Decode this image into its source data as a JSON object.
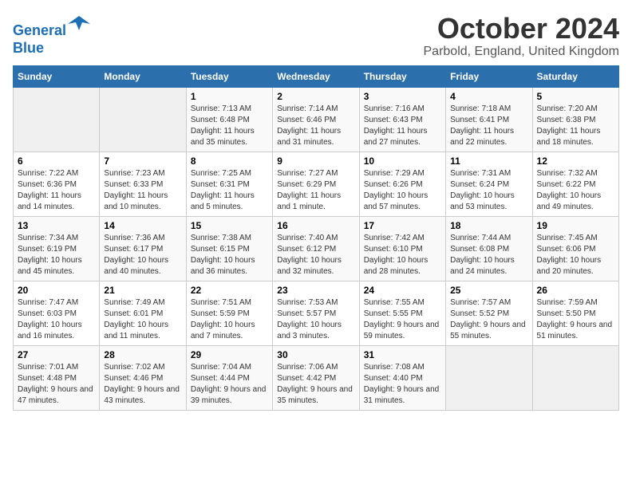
{
  "logo": {
    "line1": "General",
    "line2": "Blue"
  },
  "title": "October 2024",
  "location": "Parbold, England, United Kingdom",
  "headers": [
    "Sunday",
    "Monday",
    "Tuesday",
    "Wednesday",
    "Thursday",
    "Friday",
    "Saturday"
  ],
  "weeks": [
    [
      {
        "day": "",
        "info": ""
      },
      {
        "day": "",
        "info": ""
      },
      {
        "day": "1",
        "info": "Sunrise: 7:13 AM\nSunset: 6:48 PM\nDaylight: 11 hours and 35 minutes."
      },
      {
        "day": "2",
        "info": "Sunrise: 7:14 AM\nSunset: 6:46 PM\nDaylight: 11 hours and 31 minutes."
      },
      {
        "day": "3",
        "info": "Sunrise: 7:16 AM\nSunset: 6:43 PM\nDaylight: 11 hours and 27 minutes."
      },
      {
        "day": "4",
        "info": "Sunrise: 7:18 AM\nSunset: 6:41 PM\nDaylight: 11 hours and 22 minutes."
      },
      {
        "day": "5",
        "info": "Sunrise: 7:20 AM\nSunset: 6:38 PM\nDaylight: 11 hours and 18 minutes."
      }
    ],
    [
      {
        "day": "6",
        "info": "Sunrise: 7:22 AM\nSunset: 6:36 PM\nDaylight: 11 hours and 14 minutes."
      },
      {
        "day": "7",
        "info": "Sunrise: 7:23 AM\nSunset: 6:33 PM\nDaylight: 11 hours and 10 minutes."
      },
      {
        "day": "8",
        "info": "Sunrise: 7:25 AM\nSunset: 6:31 PM\nDaylight: 11 hours and 5 minutes."
      },
      {
        "day": "9",
        "info": "Sunrise: 7:27 AM\nSunset: 6:29 PM\nDaylight: 11 hours and 1 minute."
      },
      {
        "day": "10",
        "info": "Sunrise: 7:29 AM\nSunset: 6:26 PM\nDaylight: 10 hours and 57 minutes."
      },
      {
        "day": "11",
        "info": "Sunrise: 7:31 AM\nSunset: 6:24 PM\nDaylight: 10 hours and 53 minutes."
      },
      {
        "day": "12",
        "info": "Sunrise: 7:32 AM\nSunset: 6:22 PM\nDaylight: 10 hours and 49 minutes."
      }
    ],
    [
      {
        "day": "13",
        "info": "Sunrise: 7:34 AM\nSunset: 6:19 PM\nDaylight: 10 hours and 45 minutes."
      },
      {
        "day": "14",
        "info": "Sunrise: 7:36 AM\nSunset: 6:17 PM\nDaylight: 10 hours and 40 minutes."
      },
      {
        "day": "15",
        "info": "Sunrise: 7:38 AM\nSunset: 6:15 PM\nDaylight: 10 hours and 36 minutes."
      },
      {
        "day": "16",
        "info": "Sunrise: 7:40 AM\nSunset: 6:12 PM\nDaylight: 10 hours and 32 minutes."
      },
      {
        "day": "17",
        "info": "Sunrise: 7:42 AM\nSunset: 6:10 PM\nDaylight: 10 hours and 28 minutes."
      },
      {
        "day": "18",
        "info": "Sunrise: 7:44 AM\nSunset: 6:08 PM\nDaylight: 10 hours and 24 minutes."
      },
      {
        "day": "19",
        "info": "Sunrise: 7:45 AM\nSunset: 6:06 PM\nDaylight: 10 hours and 20 minutes."
      }
    ],
    [
      {
        "day": "20",
        "info": "Sunrise: 7:47 AM\nSunset: 6:03 PM\nDaylight: 10 hours and 16 minutes."
      },
      {
        "day": "21",
        "info": "Sunrise: 7:49 AM\nSunset: 6:01 PM\nDaylight: 10 hours and 11 minutes."
      },
      {
        "day": "22",
        "info": "Sunrise: 7:51 AM\nSunset: 5:59 PM\nDaylight: 10 hours and 7 minutes."
      },
      {
        "day": "23",
        "info": "Sunrise: 7:53 AM\nSunset: 5:57 PM\nDaylight: 10 hours and 3 minutes."
      },
      {
        "day": "24",
        "info": "Sunrise: 7:55 AM\nSunset: 5:55 PM\nDaylight: 9 hours and 59 minutes."
      },
      {
        "day": "25",
        "info": "Sunrise: 7:57 AM\nSunset: 5:52 PM\nDaylight: 9 hours and 55 minutes."
      },
      {
        "day": "26",
        "info": "Sunrise: 7:59 AM\nSunset: 5:50 PM\nDaylight: 9 hours and 51 minutes."
      }
    ],
    [
      {
        "day": "27",
        "info": "Sunrise: 7:01 AM\nSunset: 4:48 PM\nDaylight: 9 hours and 47 minutes."
      },
      {
        "day": "28",
        "info": "Sunrise: 7:02 AM\nSunset: 4:46 PM\nDaylight: 9 hours and 43 minutes."
      },
      {
        "day": "29",
        "info": "Sunrise: 7:04 AM\nSunset: 4:44 PM\nDaylight: 9 hours and 39 minutes."
      },
      {
        "day": "30",
        "info": "Sunrise: 7:06 AM\nSunset: 4:42 PM\nDaylight: 9 hours and 35 minutes."
      },
      {
        "day": "31",
        "info": "Sunrise: 7:08 AM\nSunset: 4:40 PM\nDaylight: 9 hours and 31 minutes."
      },
      {
        "day": "",
        "info": ""
      },
      {
        "day": "",
        "info": ""
      }
    ]
  ]
}
